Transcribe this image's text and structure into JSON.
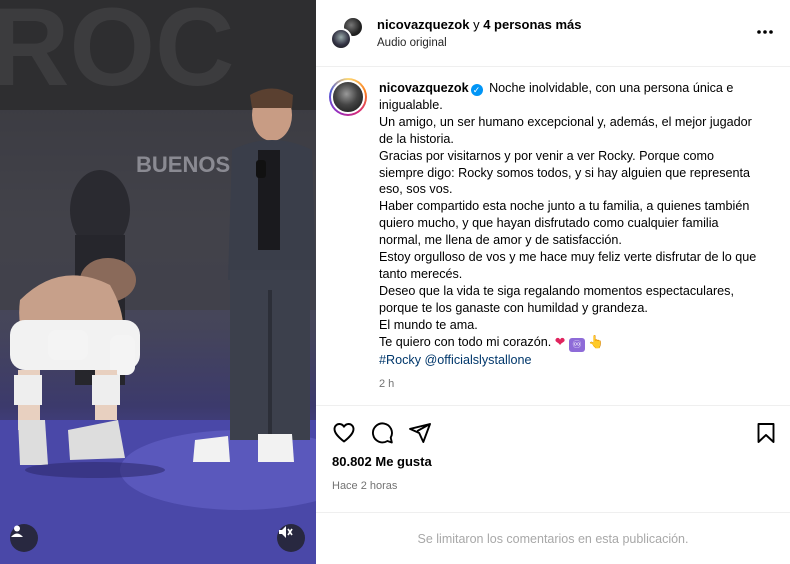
{
  "header": {
    "username": "nicovazquezok",
    "others_prefix": " y ",
    "others_bold": "4 personas más",
    "audio_label": "Audio original",
    "more_icon": "more-horizontal-icon"
  },
  "caption": {
    "username": "nicovazquezok",
    "verified": true,
    "text": " Noche inolvidable, con una persona única e inigualable.\nUn amigo, un ser humano excepcional y, además, el mejor jugador de la historia.\nGracias por visitarnos y por venir a ver Rocky. Porque como siempre digo: Rocky somos todos, y si hay alguien que representa eso, sos vos.\nHaber compartido esta noche junto a tu familia, a quienes también quiero mucho, y que hayan disfrutado como cualquier familia normal, me llena de amor y de satisfacción.\nEstoy orgulloso de vos y me hace muy feliz verte disfrutar de lo que tanto merecés.\nDeseo que la vida te siga regalando momentos espectaculares, porque te los ganaste con humildad y grandeza.\nEl mundo te ama.\nTe quiero con todo mi corazón. ",
    "emojis": [
      "❤",
      "♾",
      "👆"
    ],
    "hashtag": "#Rocky",
    "mention": "@officialslystallone",
    "time": "2 h"
  },
  "actions": {
    "like_icon": "heart-icon",
    "comment_icon": "comment-icon",
    "share_icon": "share-icon",
    "save_icon": "bookmark-icon"
  },
  "stats": {
    "likes": "80.802 Me gusta",
    "time_ago": "Hace 2 horas"
  },
  "comments": {
    "limited_text": "Se limitaron los comentarios en esta publicación."
  },
  "media": {
    "stage_text": "BUENOS",
    "tag_icon": "user-tag-icon",
    "mute_icon": "mute-icon"
  }
}
